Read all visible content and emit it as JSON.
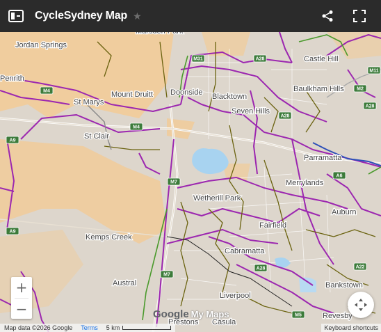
{
  "header": {
    "title": "CycleSydney Map",
    "star_glyph": "★",
    "icons": [
      "side-panel-icon",
      "star-icon",
      "share-icon",
      "fullscreen-icon"
    ]
  },
  "places": [
    "Jordan Springs",
    "Marsden Park",
    "Castle Hill",
    "Penrith",
    "St Marys",
    "Mount Druitt",
    "Doonside",
    "Blacktown",
    "Baulkham Hills",
    "Seven Hills",
    "St Clair",
    "Parramatta",
    "Merrylands",
    "Wetherill Park",
    "Auburn",
    "Fairfield",
    "Kemps Creek",
    "Cabramatta",
    "Austral",
    "Liverpool",
    "Bankstown",
    "Prestons",
    "Casula",
    "Revesby"
  ],
  "road_shields": [
    "M4",
    "M7",
    "A9",
    "M4",
    "A9",
    "A28",
    "M2",
    "A28",
    "A6",
    "M7",
    "A22",
    "M31",
    "A28",
    "M11",
    "A28",
    "M5"
  ],
  "map_colors": {
    "land": "#ddd6cc",
    "urban_fringe": "#f4c890",
    "water": "#a8d3f0",
    "cycle_route": "#9c27b0",
    "on_road": "#6b6310",
    "shared_path": "#4a9a2c"
  },
  "zoom": {
    "in": "+",
    "out": "−"
  },
  "fit_icon": "recenter-icon",
  "logo": {
    "google": "Google",
    "my_maps": "My Maps"
  },
  "footer": {
    "attribution": "Map data ©2026 Google",
    "terms": "Terms",
    "scale": "5 km",
    "shortcuts": "Keyboard shortcuts"
  }
}
